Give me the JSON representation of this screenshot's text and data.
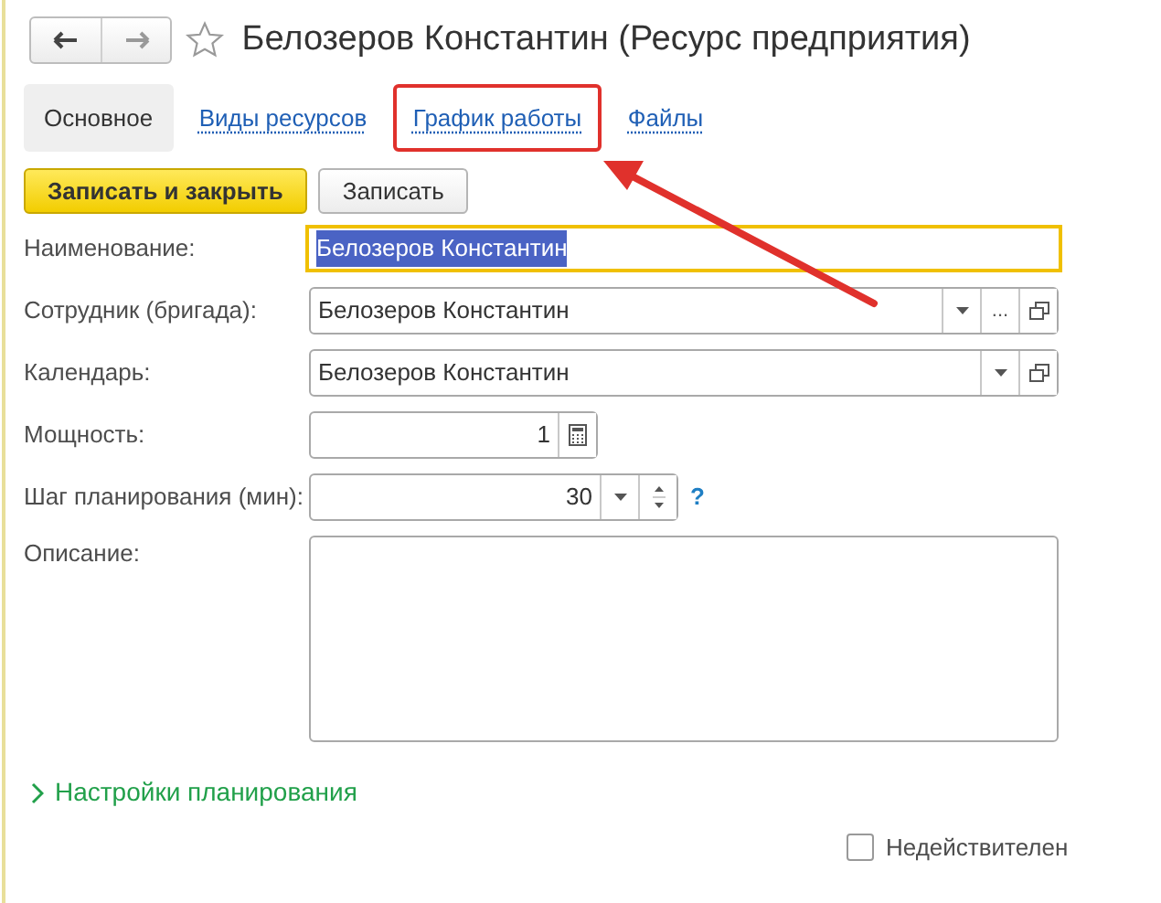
{
  "window": {
    "title": "Белозеров Константин (Ресурс предприятия)",
    "favorite": false
  },
  "tabs": [
    {
      "label": "Основное",
      "selected": true,
      "highlighted": false
    },
    {
      "label": "Виды ресурсов",
      "selected": false,
      "highlighted": false
    },
    {
      "label": "График работы",
      "selected": false,
      "highlighted": true
    },
    {
      "label": "Файлы",
      "selected": false,
      "highlighted": false
    }
  ],
  "callout_arrow": true,
  "buttons": [
    {
      "label": "Записать и закрыть",
      "kind": "primary"
    },
    {
      "label": "Записать",
      "kind": "default"
    }
  ],
  "fields": [
    {
      "label": "Наименование:",
      "kind": "text",
      "value": "Белозеров Константин",
      "focused": true
    },
    {
      "label": "Сотрудник (бригада):",
      "kind": "reference",
      "value": "Белозеров Константин",
      "actions": [
        {
          "kind": "dropdown"
        },
        {
          "kind": "select",
          "label": "..."
        },
        {
          "kind": "open"
        }
      ]
    },
    {
      "label": "Календарь:",
      "kind": "reference",
      "value": "Белозеров Константин",
      "actions": [
        {
          "kind": "dropdown"
        },
        {
          "kind": "open"
        }
      ]
    },
    {
      "label": "Мощность:",
      "kind": "number",
      "value": "1"
    },
    {
      "label": "Шаг планирования (мин):",
      "kind": "spin",
      "value": "30",
      "help": "?"
    },
    {
      "label": "Описание:",
      "kind": "memo"
    }
  ],
  "group": {
    "label": "Настройки планирования",
    "expanded": false
  },
  "checkbox": {
    "label": "Недействителен",
    "checked": false
  }
}
